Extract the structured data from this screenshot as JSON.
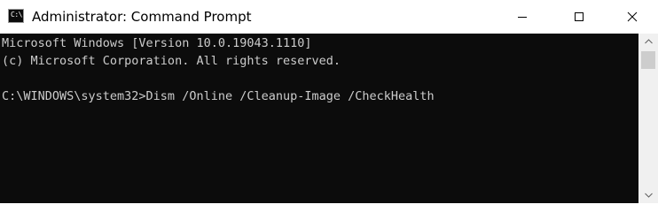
{
  "window": {
    "title": "Administrator: Command Prompt",
    "icon": "cmd-icon",
    "icon_glyph": "C:\\",
    "controls": {
      "minimize": "minimize-icon",
      "maximize": "maximize-icon",
      "close": "close-icon"
    }
  },
  "console": {
    "background": "#0c0c0c",
    "foreground": "#cccccc",
    "lines": [
      "Microsoft Windows [Version 10.0.19043.1110]",
      "(c) Microsoft Corporation. All rights reserved.",
      "C:\\WINDOWS\\system32>Dism /Online /Cleanup-Image /CheckHealth"
    ]
  },
  "scrollbar": {
    "up_icon": "scroll-up-arrow-icon",
    "down_icon": "scroll-down-arrow-icon"
  }
}
